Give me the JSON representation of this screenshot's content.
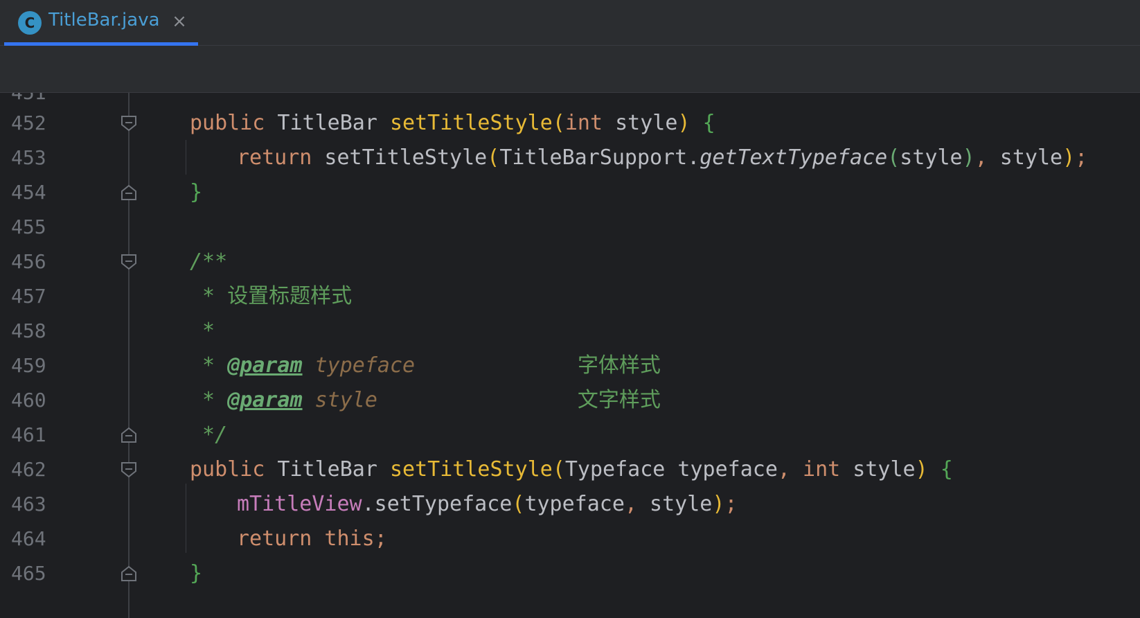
{
  "tab": {
    "icon_letter": "C",
    "filename": "TitleBar.java",
    "close_glyph": "×"
  },
  "gutter": {
    "partial_top": "451",
    "lines": [
      "452",
      "453",
      "454",
      "455",
      "456",
      "457",
      "458",
      "459",
      "460",
      "461",
      "462",
      "463",
      "464",
      "465"
    ]
  },
  "code": {
    "l452": {
      "kw": "public",
      "type": " TitleBar ",
      "name": "setTitleStyle",
      "p_open": "(",
      "kw2": "int",
      "arg": " style",
      "p_close": ")",
      "sp": " ",
      "brace": "{"
    },
    "l453": {
      "kw": "return",
      "call": " setTitleStyle",
      "p_open": "(",
      "cls": "TitleBarSupport.",
      "method": "getTextTypeface",
      "p2_open": "(",
      "arg": "style",
      "p2_close": ")",
      "comma": ",",
      "arg2": " style",
      "p_close": ")",
      "semi": ";"
    },
    "l454": {
      "brace": "}"
    },
    "l456": {
      "text": "/**"
    },
    "l457": {
      "star": " * ",
      "text": "设置标题样式"
    },
    "l458": {
      "text": " *"
    },
    "l459": {
      "star": " * ",
      "tag": "@param",
      "name": " typeface",
      "gap": "             ",
      "desc": "字体样式"
    },
    "l460": {
      "star": " * ",
      "tag": "@param",
      "name": " style",
      "gap": "                ",
      "desc": "文字样式"
    },
    "l461": {
      "text": " */"
    },
    "l462": {
      "kw": "public",
      "type": " TitleBar ",
      "name": "setTitleStyle",
      "p_open": "(",
      "type2": "Typeface typeface",
      "comma": ",",
      "kw2": " int",
      "arg": " style",
      "p_close": ")",
      "sp": " ",
      "brace": "{"
    },
    "l463": {
      "field": "mTitleView",
      "call": ".setTypeface",
      "p_open": "(",
      "arg": "typeface",
      "comma": ",",
      "arg2": " style",
      "p_close": ")",
      "semi": ";"
    },
    "l464": {
      "kw": "return",
      "this": " this",
      "semi": ";"
    },
    "l465": {
      "brace": "}"
    }
  },
  "colors": {
    "background": "#1e1f22",
    "chrome": "#2b2d30",
    "accent": "#3574f0",
    "keyword": "#cf8e6d",
    "method": "#e8ba36",
    "comment": "#5f9e5c"
  }
}
